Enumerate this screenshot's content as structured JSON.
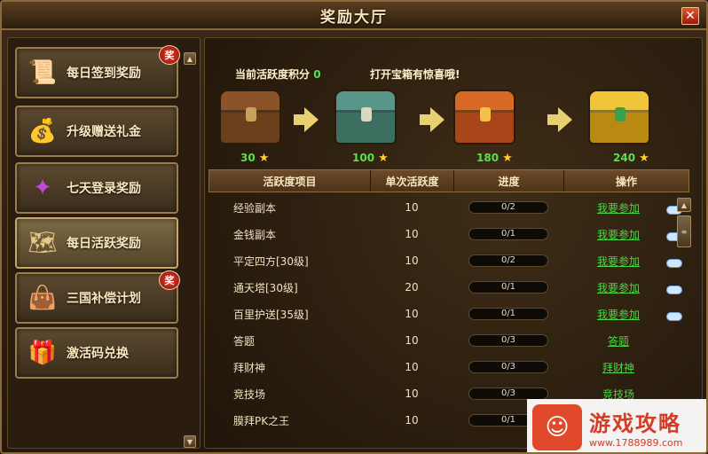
{
  "window": {
    "title": "奖励大厅",
    "close_label": "✕"
  },
  "sidebar": {
    "items": [
      {
        "label": "每日签到奖励",
        "icon": "scroll-icon",
        "badge": "奖"
      },
      {
        "label": "升级赠送礼金",
        "icon": "gold-ingot-icon",
        "badge": ""
      },
      {
        "label": "七天登录奖励",
        "icon": "magic-gem-icon",
        "badge": ""
      },
      {
        "label": "每日活跃奖励",
        "icon": "map-scroll-icon",
        "badge": ""
      },
      {
        "label": "三国补偿计划",
        "icon": "money-bag-icon",
        "badge": "奖"
      },
      {
        "label": "激活码兑换",
        "icon": "gift-pack-icon",
        "badge": ""
      }
    ]
  },
  "main": {
    "activity_label": "当前活跃度积分",
    "activity_value": "0",
    "chest_hint": "打开宝箱有惊喜哦!",
    "chests": [
      {
        "value": "30",
        "color": "#7a4a24"
      },
      {
        "value": "100",
        "color": "#3f7a6a"
      },
      {
        "value": "180",
        "color": "#c4561e"
      },
      {
        "value": "240",
        "color": "#d8a21a"
      }
    ],
    "table": {
      "headers": [
        "活跃度项目",
        "单次活跃度",
        "进度",
        "操作"
      ],
      "rows": [
        {
          "name": "经验副本",
          "value": "10",
          "progress": "0/2",
          "action": "我要参加",
          "cloud": true
        },
        {
          "name": "金钱副本",
          "value": "10",
          "progress": "0/1",
          "action": "我要参加",
          "cloud": true
        },
        {
          "name": "平定四方[30级]",
          "value": "10",
          "progress": "0/2",
          "action": "我要参加",
          "cloud": true
        },
        {
          "name": "通天塔[30级]",
          "value": "20",
          "progress": "0/1",
          "action": "我要参加",
          "cloud": true
        },
        {
          "name": "百里护送[35级]",
          "value": "10",
          "progress": "0/1",
          "action": "我要参加",
          "cloud": true
        },
        {
          "name": "答题",
          "value": "10",
          "progress": "0/3",
          "action": "答题",
          "cloud": false
        },
        {
          "name": "拜财神",
          "value": "10",
          "progress": "0/3",
          "action": "拜财神",
          "cloud": false
        },
        {
          "name": "竞技场",
          "value": "10",
          "progress": "0/3",
          "action": "竞技场",
          "cloud": false
        },
        {
          "name": "膜拜PK之王",
          "value": "10",
          "progress": "0/1",
          "action": "",
          "cloud": false
        }
      ]
    }
  },
  "watermark": {
    "title": "游戏攻略",
    "url": "www.1788989.com"
  }
}
